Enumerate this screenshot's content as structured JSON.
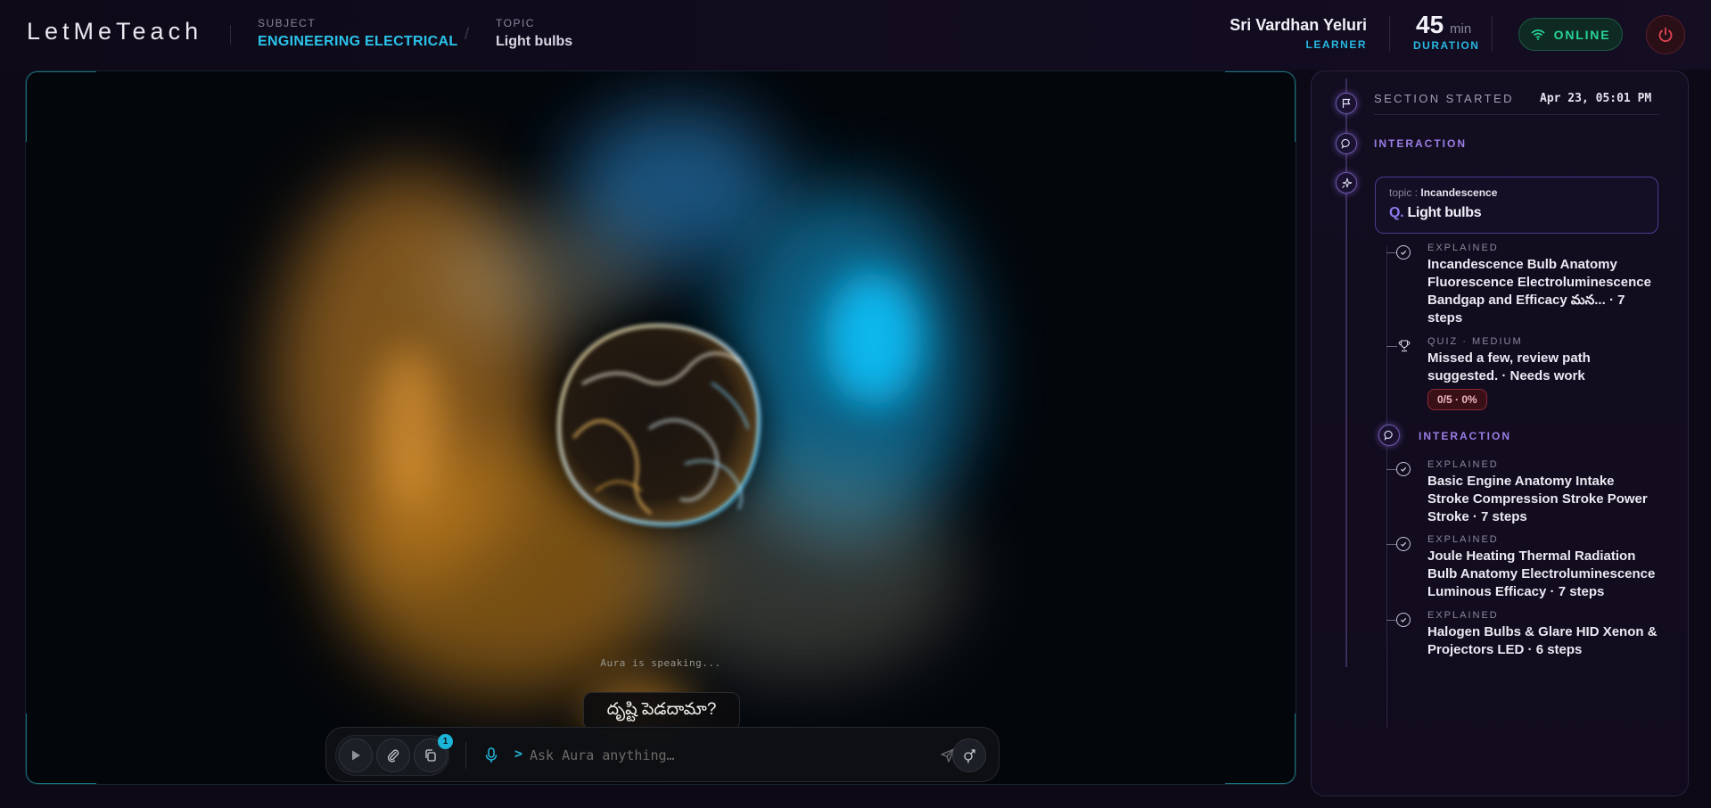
{
  "header": {
    "logo": "LetMeTeach",
    "subject_label": "SUBJECT",
    "subject_value": "ENGINEERING ELECTRICAL",
    "topic_label": "TOPIC",
    "topic_value": "Light bulbs",
    "user_name": "Sri Vardhan Yeluri",
    "user_role": "LEARNER",
    "duration_value": "45",
    "duration_unit": "min",
    "duration_label": "DURATION",
    "status": "ONLINE"
  },
  "stage": {
    "speaking_text": "Aura is speaking...",
    "caption": "దృష్టి పెడదామా?",
    "input_placeholder": "Ask Aura anything…",
    "prompt_caret": ">",
    "attachment_badge": "1"
  },
  "timeline": {
    "section_label": "SECTION STARTED",
    "section_date": "Apr 23, 05:01 PM",
    "interaction_label_1": "INTERACTION",
    "question": {
      "topic_prefix": "topic :",
      "topic": "Incandescence",
      "q_prefix": "Q.",
      "title": "Light bulbs"
    },
    "items_a": [
      {
        "kind": "EXPLAINED",
        "text": "Incandescence Bulb Anatomy Fluorescence Electroluminescence Bandgap and Efficacy మన... · 7 steps"
      },
      {
        "kind": "QUIZ · MEDIUM",
        "text": "Missed a few, review path suggested. · Needs work",
        "score": "0/5 · 0%"
      }
    ],
    "interaction_label_2": "INTERACTION",
    "items_b": [
      {
        "kind": "EXPLAINED",
        "text": "Basic Engine Anatomy Intake Stroke Compression Stroke Power Stroke · 7 steps"
      },
      {
        "kind": "EXPLAINED",
        "text": "Joule Heating Thermal Radiation Bulb Anatomy Electroluminescence Luminous Efficacy · 7 steps"
      },
      {
        "kind": "EXPLAINED",
        "text": "Halogen Bulbs & Glare HID Xenon & Projectors LED · 6 steps"
      }
    ]
  },
  "colors": {
    "accent_cyan": "#2bc4ec",
    "accent_violet": "#8c7cf0",
    "online_green": "#29d39a",
    "danger_red": "#e0454f"
  },
  "icons": [
    "flag-icon",
    "chat-icon",
    "sparkle-icon",
    "check-circle-icon",
    "trophy-icon",
    "wifi-icon",
    "power-icon",
    "play-icon",
    "paperclip-icon",
    "copy-icon",
    "mic-icon",
    "send-icon",
    "gender-icon"
  ]
}
